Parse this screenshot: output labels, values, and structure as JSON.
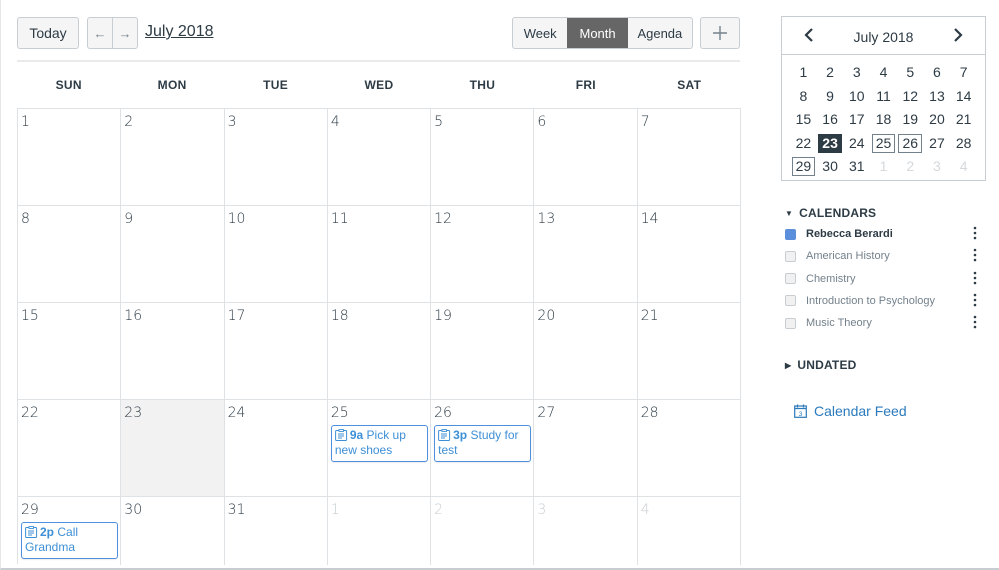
{
  "toolbar": {
    "today_label": "Today",
    "prev_label": "←",
    "next_label": "→",
    "month_title": "July 2018",
    "views": [
      {
        "label": "Week",
        "active": false
      },
      {
        "label": "Month",
        "active": true
      },
      {
        "label": "Agenda",
        "active": false
      }
    ],
    "add_label": "+"
  },
  "calendar": {
    "weekdays": [
      "SUN",
      "MON",
      "TUE",
      "WED",
      "THU",
      "FRI",
      "SAT"
    ],
    "weeks": [
      [
        {
          "day": "1"
        },
        {
          "day": "2"
        },
        {
          "day": "3"
        },
        {
          "day": "4"
        },
        {
          "day": "5"
        },
        {
          "day": "6"
        },
        {
          "day": "7"
        }
      ],
      [
        {
          "day": "8"
        },
        {
          "day": "9"
        },
        {
          "day": "10"
        },
        {
          "day": "11"
        },
        {
          "day": "12"
        },
        {
          "day": "13"
        },
        {
          "day": "14"
        }
      ],
      [
        {
          "day": "15"
        },
        {
          "day": "16"
        },
        {
          "day": "17"
        },
        {
          "day": "18"
        },
        {
          "day": "19"
        },
        {
          "day": "20"
        },
        {
          "day": "21"
        }
      ],
      [
        {
          "day": "22"
        },
        {
          "day": "23",
          "today": true
        },
        {
          "day": "24"
        },
        {
          "day": "25",
          "events": [
            {
              "time": "9a",
              "title": "Pick up new shoes"
            }
          ]
        },
        {
          "day": "26",
          "events": [
            {
              "time": "3p",
              "title": "Study for test"
            }
          ]
        },
        {
          "day": "27"
        },
        {
          "day": "28"
        }
      ],
      [
        {
          "day": "29",
          "events": [
            {
              "time": "2p",
              "title": "Call Grandma"
            }
          ]
        },
        {
          "day": "30"
        },
        {
          "day": "31"
        },
        {
          "day": "1",
          "other": true
        },
        {
          "day": "2",
          "other": true
        },
        {
          "day": "3",
          "other": true
        },
        {
          "day": "4",
          "other": true
        }
      ]
    ]
  },
  "mini_calendar": {
    "title": "July 2018",
    "prev_icon": "‹",
    "next_icon": "›",
    "weeks": [
      [
        {
          "d": "1"
        },
        {
          "d": "2"
        },
        {
          "d": "3"
        },
        {
          "d": "4"
        },
        {
          "d": "5"
        },
        {
          "d": "6"
        },
        {
          "d": "7"
        }
      ],
      [
        {
          "d": "8"
        },
        {
          "d": "9"
        },
        {
          "d": "10"
        },
        {
          "d": "11"
        },
        {
          "d": "12"
        },
        {
          "d": "13"
        },
        {
          "d": "14"
        }
      ],
      [
        {
          "d": "15"
        },
        {
          "d": "16"
        },
        {
          "d": "17"
        },
        {
          "d": "18"
        },
        {
          "d": "19"
        },
        {
          "d": "20"
        },
        {
          "d": "21"
        }
      ],
      [
        {
          "d": "22"
        },
        {
          "d": "23",
          "today": true
        },
        {
          "d": "24"
        },
        {
          "d": "25",
          "event": true
        },
        {
          "d": "26",
          "event": true
        },
        {
          "d": "27"
        },
        {
          "d": "28"
        }
      ],
      [
        {
          "d": "29",
          "event": true
        },
        {
          "d": "30"
        },
        {
          "d": "31"
        },
        {
          "d": "1",
          "other": true
        },
        {
          "d": "2",
          "other": true
        },
        {
          "d": "3",
          "other": true
        },
        {
          "d": "4",
          "other": true
        }
      ]
    ]
  },
  "sidebar": {
    "calendars_label": "CALENDARS",
    "calendars": [
      {
        "name": "Rebecca Berardi",
        "checked": true,
        "color": "#5b8fdb"
      },
      {
        "name": "American History",
        "checked": false
      },
      {
        "name": "Chemistry",
        "checked": false
      },
      {
        "name": "Introduction to Psychology",
        "checked": false
      },
      {
        "name": "Music Theory",
        "checked": false
      }
    ],
    "undated_label": "UNDATED",
    "feed_label": "Calendar Feed"
  }
}
